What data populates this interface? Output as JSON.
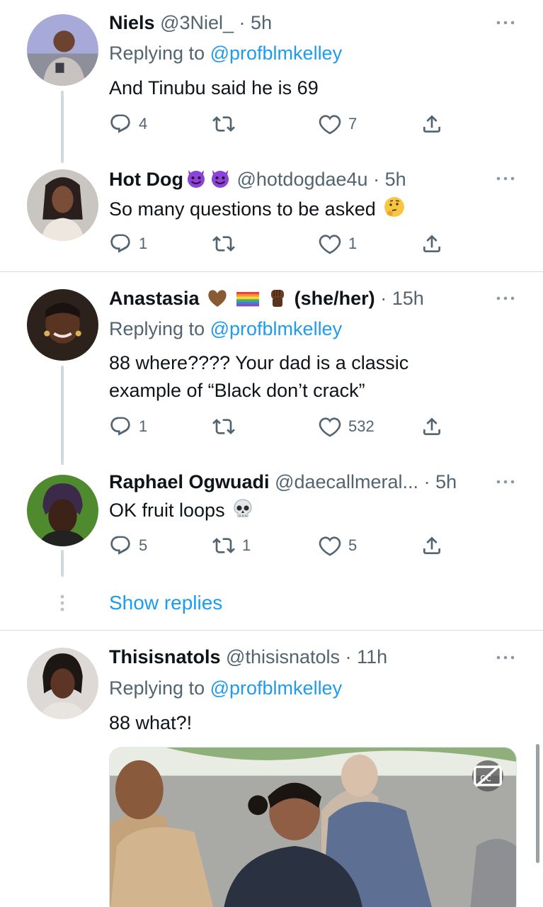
{
  "tweets": [
    {
      "name": "Niels",
      "handle": "@3Niel_",
      "time": "5h",
      "replying_label": "Replying to",
      "replying_to": "@profblmkelley",
      "text": "And Tinubu said he is 69",
      "replies": "4",
      "retweets": "",
      "likes": "7"
    },
    {
      "name": "Hot Dog",
      "handle": "@hotdogdae4u",
      "time": "5h",
      "text": "So many questions to be asked",
      "replies": "1",
      "retweets": "",
      "likes": "1"
    },
    {
      "name": "Anastasia",
      "name_suffix": "(she/her)",
      "time": "15h",
      "replying_label": "Replying to",
      "replying_to": "@profblmkelley",
      "text_line1": "88 where???? Your dad is a classic",
      "text_line2": "example of “Black don’t crack”",
      "replies": "1",
      "retweets": "",
      "likes": "532"
    },
    {
      "name": "Raphael Ogwuadi",
      "handle": "@daecallmeral...",
      "time": "5h",
      "text": "OK fruit loops",
      "replies": "5",
      "retweets": "1",
      "likes": "5"
    },
    {
      "name": "Thisisnatols",
      "handle": "@thisisnatols",
      "time": "11h",
      "replying_label": "Replying to",
      "replying_to": "@profblmkelley",
      "text": "88 what?!"
    }
  ],
  "show_replies": "Show replies",
  "separator": "·",
  "icons": {
    "reply": "reply-icon",
    "retweet": "retweet-icon",
    "like": "heart-icon",
    "share": "share-icon",
    "more": "more-icon",
    "captions": "closed-captions-icon"
  },
  "colors": {
    "accent": "#1d9bf0",
    "secondary_text": "#536471",
    "primary_text": "#0f1419",
    "thread_line": "#cfd9de"
  }
}
